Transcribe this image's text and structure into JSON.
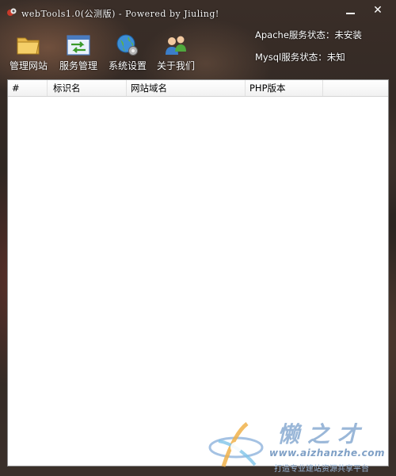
{
  "window": {
    "title": "webTools1.0(公测版) - Powered by Jiuling!",
    "minimize_label": "—",
    "close_label": "✕"
  },
  "toolbar": {
    "items": [
      {
        "label": "管理网站",
        "icon": "folder-icon"
      },
      {
        "label": "服务管理",
        "icon": "service-arrows-icon"
      },
      {
        "label": "系统设置",
        "icon": "globe-gear-icon"
      },
      {
        "label": "关于我们",
        "icon": "users-icon"
      }
    ]
  },
  "status": {
    "apache": "Apache服务状态：未安装",
    "mysql": "Mysql服务状态：未知"
  },
  "table": {
    "columns": [
      "#",
      "标识名",
      "网站域名",
      "PHP版本",
      ""
    ],
    "rows": []
  },
  "watermark": {
    "brand": "懒之才",
    "url": "www.aizhanzhe.com",
    "slogan": "打造专业建站资源共享平台"
  },
  "colors": {
    "list_background": "#ffffff",
    "title_text": "#f4f4f4",
    "watermark_blue": "#9ab7d8"
  }
}
